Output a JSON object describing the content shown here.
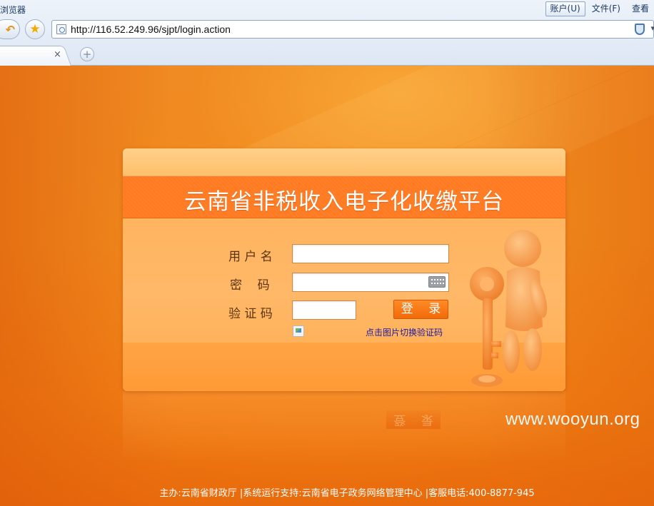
{
  "browser": {
    "app_title": "浏览器",
    "menu": [
      "账户(U)",
      "文件(F)",
      "查看"
    ],
    "address_url": "http://116.52.249.96/sjpt/login.action",
    "tab_close": "×",
    "new_tab": "+",
    "back_glyph": "↶",
    "favorite_glyph": "★",
    "dropdown_glyph": "▾"
  },
  "login": {
    "title": "云南省非税收入电子化收缴平台",
    "username_label": "用 户 名",
    "username_value": "",
    "password_label": "密    码",
    "password_value": "",
    "captcha_label": "验 证 码",
    "captcha_value": "",
    "login_button": "登 录",
    "captcha_switch_link": "点击图片切换验证码"
  },
  "reflection_text": "登 录",
  "footer": "主办:云南省财政厅 |系统运行支持:云南省电子政务网络管理中心 |客服电话:400-8877-945",
  "watermark": "www.wooyun.org",
  "colors": {
    "background": "#f08a1e",
    "title_band": "#ff7a22",
    "login_button": "#f26a08",
    "link": "#1a1aa8"
  },
  "icons": [
    "back-icon",
    "favorite-star-icon",
    "page-icon",
    "shield-icon",
    "keyboard-icon",
    "broken-image-icon",
    "figure-with-key-illustration"
  ]
}
